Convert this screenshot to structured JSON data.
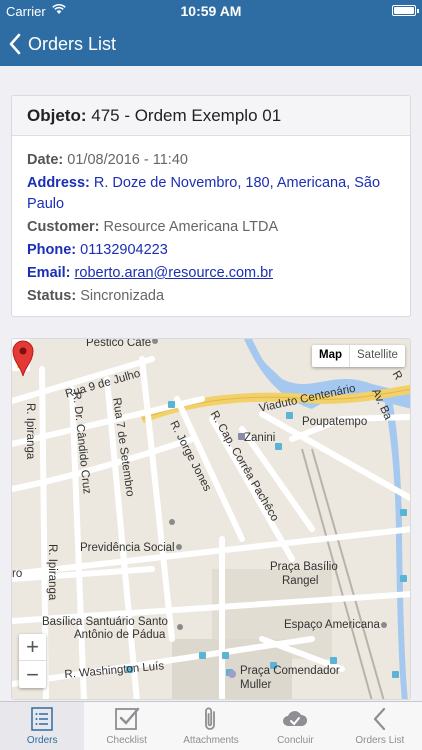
{
  "status_bar": {
    "carrier": "Carrier",
    "time": "10:59 AM"
  },
  "nav": {
    "back_label": "Orders List"
  },
  "order": {
    "title_key": "Objeto:",
    "title_value": "475 - Ordem Exemplo 01",
    "date_key": "Date:",
    "date_value": "01/08/2016 - 11:40",
    "address_key": "Address:",
    "address_value": "R. Doze de Novembro, 180, Americana, São Paulo",
    "customer_key": "Customer:",
    "customer_value": "Resource Americana LTDA",
    "phone_key": "Phone:",
    "phone_value": "01132904223",
    "email_key": "Email:",
    "email_value": "roberto.aran@resource.com.br",
    "status_key": "Status:",
    "status_value": "Sincronizada"
  },
  "map": {
    "toggle_map": "Map",
    "toggle_satellite": "Satellite",
    "zoom_in": "+",
    "zoom_out": "−",
    "labels": {
      "pestico": "Pestico Café",
      "rua9": "Rua 9 de Julho",
      "viaduto": "Viaduto Centenário",
      "ipiranga1": "R. Ipiranga",
      "candido": "R. Dr. Cândido Cruz",
      "rua7": "Rua 7 de Setembro",
      "jorge": "R. Jorge Jones",
      "correa": "R. Cap. Corrêa Pachêco",
      "zanini": "Zanini",
      "poupatempo": "Poupatempo",
      "previdencia": "Previdência Social",
      "praca_basilio": "Praça Basílio",
      "rangel": "Rangel",
      "ro": "ro",
      "ipiranga2": "R. Ipiranga",
      "basilica1": "Basílica Santuário Santo",
      "basilica2": "Antônio de Pádua",
      "espaco": "Espaço Americana",
      "washington": "R. Washington Luís",
      "comendador1": "Praça Comendador",
      "comendador2": "Muller",
      "r_right": "R",
      "av_ba": "Av. Ba"
    },
    "colors": {
      "water": "#a4c8f0",
      "highway": "#f2d16b",
      "road": "#ffffff",
      "land": "#ece8df",
      "pin": "#e53935"
    }
  },
  "tabs": [
    {
      "label": "Orders",
      "icon": "list-icon",
      "active": true
    },
    {
      "label": "Checklist",
      "icon": "checklist-icon",
      "active": false
    },
    {
      "label": "Attachments",
      "icon": "paperclip-icon",
      "active": false
    },
    {
      "label": "Concluir",
      "icon": "cloud-check-icon",
      "active": false
    },
    {
      "label": "Orders List",
      "icon": "chevron-left-icon",
      "active": false
    }
  ]
}
